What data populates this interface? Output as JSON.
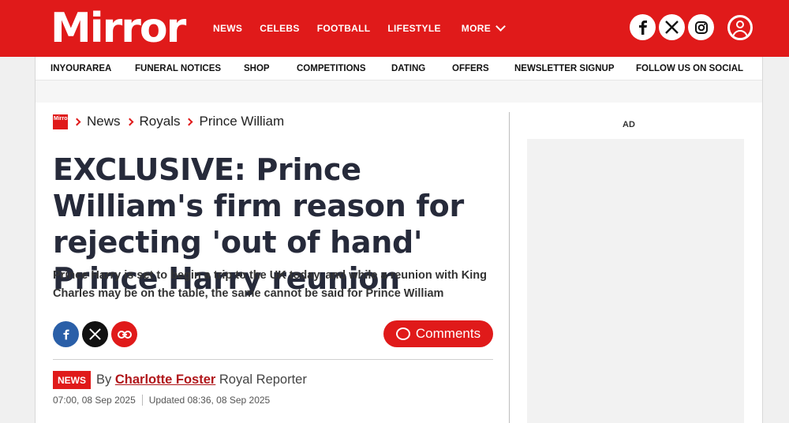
{
  "header": {
    "logo": "Mirror",
    "nav": [
      "NEWS",
      "CELEBS",
      "FOOTBALL",
      "LIFESTYLE"
    ],
    "more_label": "MORE",
    "social_icons": [
      "facebook-icon",
      "x-icon",
      "instagram-icon"
    ],
    "account_icon": "user-icon",
    "brand_color": "#e01a1a"
  },
  "subnav": [
    "INYOURAREA",
    "FUNERAL NOTICES",
    "SHOP",
    "COMPETITIONS",
    "DATING",
    "OFFERS",
    "NEWSLETTER SIGNUP",
    "FOLLOW US ON SOCIAL"
  ],
  "breadcrumb": {
    "logo_text": "Mirror",
    "items": [
      "News",
      "Royals",
      "Prince William"
    ]
  },
  "article": {
    "headline": "EXCLUSIVE: Prince William's firm reason for rejecting 'out of hand' Prince Harry reunion",
    "standfirst": "Prince Harry is set to begin a trip to the UK today, and while a reunion with King Charles may be on the table, the same cannot be said for Prince William",
    "share_icons": [
      "facebook-icon",
      "x-icon",
      "link-icon"
    ],
    "comments_label": "Comments",
    "badge": "NEWS",
    "by": "By",
    "author": "Charlotte Foster",
    "role": "Royal Reporter",
    "published": "07:00, 08 Sep 2025",
    "updated": "Updated 08:36, 08 Sep 2025"
  },
  "sidebar": {
    "ad_label": "AD"
  }
}
